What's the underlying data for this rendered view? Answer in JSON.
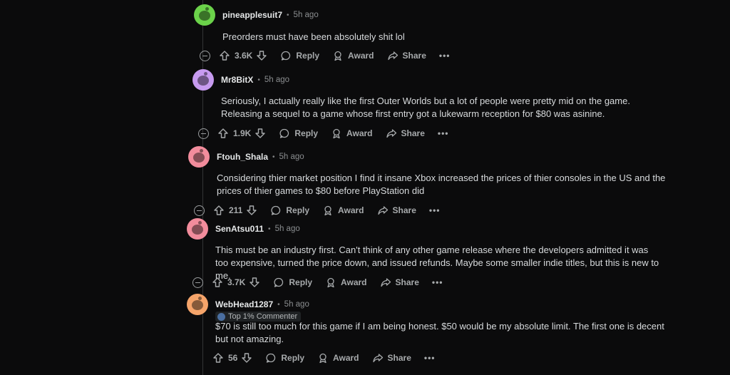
{
  "comments": [
    {
      "username": "pineapplesuit7",
      "time": "5h ago",
      "avatar_color": "#6bd24a",
      "text": "Preorders must have been absolutely shit lol",
      "votes": "3.6K",
      "reply_label": "Reply",
      "award_label": "Award",
      "share_label": "Share",
      "more_label": "•••"
    },
    {
      "username": "Mr8BitX",
      "time": "5h ago",
      "avatar_color": "#c79bf0",
      "text": "Seriously, I actually really like the first Outer Worlds but a lot of people were pretty mid on the game. Releasing a sequel to a game whose first entry got a lukewarm reception for $80 was asinine.",
      "votes": "1.9K",
      "reply_label": "Reply",
      "award_label": "Award",
      "share_label": "Share",
      "more_label": "•••"
    },
    {
      "username": "Ftouh_Shala",
      "time": "5h ago",
      "avatar_color": "#f28c9c",
      "text": "Considering thier market position I find it insane Xbox increased the prices of thier consoles in the US and the prices of thier games to $80 before PlayStation did",
      "votes": "211",
      "reply_label": "Reply",
      "award_label": "Award",
      "share_label": "Share",
      "more_label": "•••"
    },
    {
      "username": "SenAtsu011",
      "time": "5h ago",
      "avatar_color": "#f28c9c",
      "text": "This must be an industry first. Can't think of any other game release where the developers admitted it was too expensive, turned the price down, and issued refunds. Maybe some smaller indie titles, but this is new to me.",
      "votes": "3.7K",
      "reply_label": "Reply",
      "award_label": "Award",
      "share_label": "Share",
      "more_label": "•••"
    },
    {
      "username": "WebHead1287",
      "time": "5h ago",
      "avatar_color": "#f5a46a",
      "flair": "Top 1% Commenter",
      "text": "$70 is still too much for this game if I am being honest. $50 would be my absolute limit. The first one is decent but not amazing.",
      "votes": "56",
      "reply_label": "Reply",
      "award_label": "Award",
      "share_label": "Share",
      "more_label": "•••"
    }
  ],
  "separator": "•"
}
